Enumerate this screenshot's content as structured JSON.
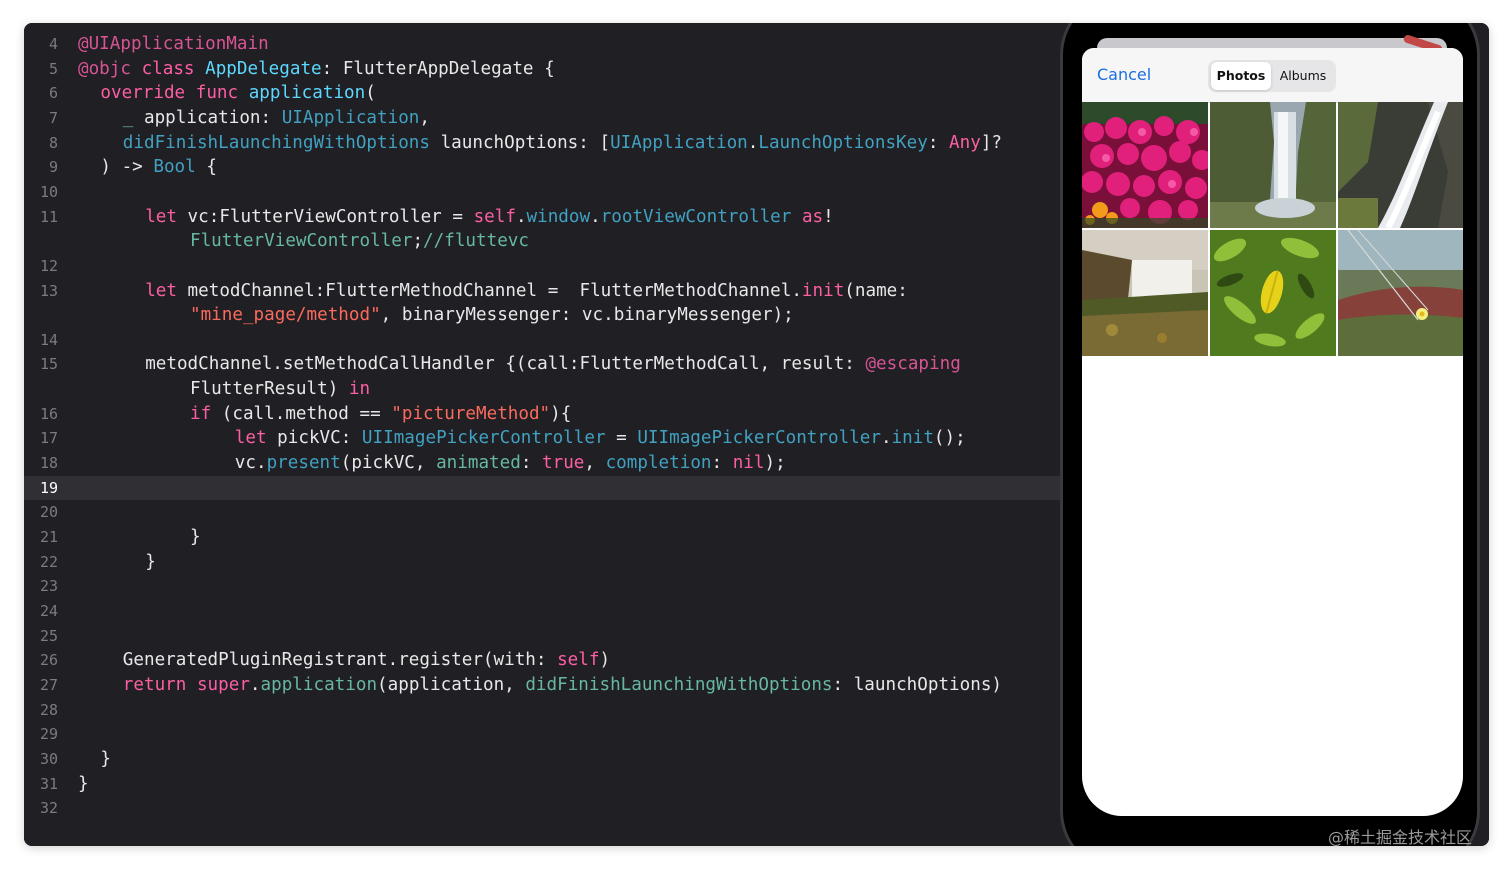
{
  "editor": {
    "current_line": 19,
    "lines": [
      {
        "num": "4",
        "indent": 0,
        "tokens": [
          {
            "t": "@UIApplicationMain",
            "c": "at"
          }
        ]
      },
      {
        "num": "5",
        "indent": 0,
        "tokens": [
          {
            "t": "@objc",
            "c": "at"
          },
          {
            "t": " "
          },
          {
            "t": "class",
            "c": "kw"
          },
          {
            "t": " "
          },
          {
            "t": "AppDelegate",
            "c": "ty"
          },
          {
            "t": ": FlutterAppDelegate {"
          }
        ]
      },
      {
        "num": "6",
        "indent": 2,
        "tokens": [
          {
            "t": "override",
            "c": "kw"
          },
          {
            "t": " "
          },
          {
            "t": "func",
            "c": "kw"
          },
          {
            "t": " "
          },
          {
            "t": "application",
            "c": "ty"
          },
          {
            "t": "("
          }
        ]
      },
      {
        "num": "7",
        "indent": 4,
        "tokens": [
          {
            "t": "_",
            "c": "fn"
          },
          {
            "t": " application: "
          },
          {
            "t": "UIApplication",
            "c": "tp"
          },
          {
            "t": ","
          }
        ]
      },
      {
        "num": "8",
        "indent": 4,
        "tokens": [
          {
            "t": "didFinishLaunchingWithOptions",
            "c": "tp"
          },
          {
            "t": " launchOptions: ["
          },
          {
            "t": "UIApplication",
            "c": "tp"
          },
          {
            "t": "."
          },
          {
            "t": "LaunchOptionsKey",
            "c": "tp"
          },
          {
            "t": ": "
          },
          {
            "t": "Any",
            "c": "kw"
          },
          {
            "t": "]?"
          }
        ]
      },
      {
        "num": "9",
        "indent": 2,
        "tokens": [
          {
            "t": ") -> "
          },
          {
            "t": "Bool",
            "c": "tp"
          },
          {
            "t": " {"
          }
        ]
      },
      {
        "num": "10",
        "indent": 0,
        "tokens": []
      },
      {
        "num": "11",
        "indent": 6,
        "tokens": [
          {
            "t": "let",
            "c": "kw"
          },
          {
            "t": " vc:FlutterViewController = "
          },
          {
            "t": "self",
            "c": "kw"
          },
          {
            "t": "."
          },
          {
            "t": "window",
            "c": "tp"
          },
          {
            "t": "."
          },
          {
            "t": "rootViewController",
            "c": "tp"
          },
          {
            "t": " "
          },
          {
            "t": "as",
            "c": "kw"
          },
          {
            "t": "!"
          }
        ]
      },
      {
        "num": "",
        "indent": 10,
        "tokens": [
          {
            "t": "FlutterViewController",
            "c": "fn"
          },
          {
            "t": ";"
          },
          {
            "t": "//fluttevc",
            "c": "fn"
          }
        ]
      },
      {
        "num": "12",
        "indent": 0,
        "tokens": []
      },
      {
        "num": "13",
        "indent": 6,
        "tokens": [
          {
            "t": "let",
            "c": "kw"
          },
          {
            "t": " metodChannel:FlutterMethodChannel =  FlutterMethodChannel."
          },
          {
            "t": "init",
            "c": "kw"
          },
          {
            "t": "(name:"
          }
        ]
      },
      {
        "num": "",
        "indent": 10,
        "tokens": [
          {
            "t": "\"mine_page/method\"",
            "c": "st"
          },
          {
            "t": ", binaryMessenger: vc.binaryMessenger);"
          }
        ]
      },
      {
        "num": "14",
        "indent": 0,
        "tokens": []
      },
      {
        "num": "15",
        "indent": 6,
        "tokens": [
          {
            "t": "metodChannel.setMethodCallHandler {(call:FlutterMethodCall, result: "
          },
          {
            "t": "@escaping",
            "c": "at"
          }
        ]
      },
      {
        "num": "",
        "indent": 10,
        "tokens": [
          {
            "t": "FlutterResult) "
          },
          {
            "t": "in",
            "c": "kw"
          }
        ]
      },
      {
        "num": "16",
        "indent": 10,
        "tokens": [
          {
            "t": "if",
            "c": "kw"
          },
          {
            "t": " (call.method == "
          },
          {
            "t": "\"pictureMethod\"",
            "c": "st"
          },
          {
            "t": "){"
          }
        ]
      },
      {
        "num": "17",
        "indent": 14,
        "tokens": [
          {
            "t": "let",
            "c": "kw"
          },
          {
            "t": " pickVC: "
          },
          {
            "t": "UIImagePickerController",
            "c": "tp"
          },
          {
            "t": " = "
          },
          {
            "t": "UIImagePickerController",
            "c": "tp"
          },
          {
            "t": "."
          },
          {
            "t": "init",
            "c": "tp"
          },
          {
            "t": "();"
          }
        ]
      },
      {
        "num": "18",
        "indent": 14,
        "tokens": [
          {
            "t": "vc."
          },
          {
            "t": "present",
            "c": "tp"
          },
          {
            "t": "(pickVC, "
          },
          {
            "t": "animated",
            "c": "fn"
          },
          {
            "t": ": "
          },
          {
            "t": "true",
            "c": "kw"
          },
          {
            "t": ", "
          },
          {
            "t": "completion",
            "c": "tp"
          },
          {
            "t": ": "
          },
          {
            "t": "nil",
            "c": "kw"
          },
          {
            "t": ");"
          }
        ]
      },
      {
        "num": "19",
        "indent": 0,
        "tokens": []
      },
      {
        "num": "20",
        "indent": 0,
        "tokens": []
      },
      {
        "num": "21",
        "indent": 10,
        "tokens": [
          {
            "t": "}"
          }
        ]
      },
      {
        "num": "22",
        "indent": 6,
        "tokens": [
          {
            "t": "}"
          }
        ]
      },
      {
        "num": "23",
        "indent": 0,
        "tokens": []
      },
      {
        "num": "24",
        "indent": 0,
        "tokens": []
      },
      {
        "num": "25",
        "indent": 0,
        "tokens": []
      },
      {
        "num": "26",
        "indent": 4,
        "tokens": [
          {
            "t": "GeneratedPluginRegistrant.register(with: "
          },
          {
            "t": "self",
            "c": "kw"
          },
          {
            "t": ")"
          }
        ]
      },
      {
        "num": "27",
        "indent": 4,
        "tokens": [
          {
            "t": "return",
            "c": "kw"
          },
          {
            "t": " "
          },
          {
            "t": "super",
            "c": "kw"
          },
          {
            "t": "."
          },
          {
            "t": "application",
            "c": "fn"
          },
          {
            "t": "(application, "
          },
          {
            "t": "didFinishLaunchingWithOptions",
            "c": "fn"
          },
          {
            "t": ": launchOptions)"
          }
        ]
      },
      {
        "num": "28",
        "indent": 0,
        "tokens": []
      },
      {
        "num": "29",
        "indent": 0,
        "tokens": []
      },
      {
        "num": "30",
        "indent": 2,
        "tokens": [
          {
            "t": "}"
          }
        ]
      },
      {
        "num": "31",
        "indent": 0,
        "tokens": [
          {
            "t": "}"
          }
        ]
      },
      {
        "num": "32",
        "indent": 0,
        "tokens": []
      }
    ]
  },
  "picker": {
    "cancel_label": "Cancel",
    "tab_photos": "Photos",
    "tab_albums": "Albums",
    "selected_tab": "Photos",
    "photos": [
      {
        "name": "red-flowers"
      },
      {
        "name": "waterfall-cliff"
      },
      {
        "name": "waterfall-stream"
      },
      {
        "name": "waterfall-coast"
      },
      {
        "name": "green-leaves"
      },
      {
        "name": "grass-flower"
      }
    ]
  },
  "colors": {
    "editor_bg": "#1f1f24",
    "keyword": "#fc5fa3",
    "type": "#5dd8ff",
    "string": "#fc6a5d",
    "ios_blue": "#1a6fe0"
  },
  "watermark": "@稀土掘金技术社区"
}
